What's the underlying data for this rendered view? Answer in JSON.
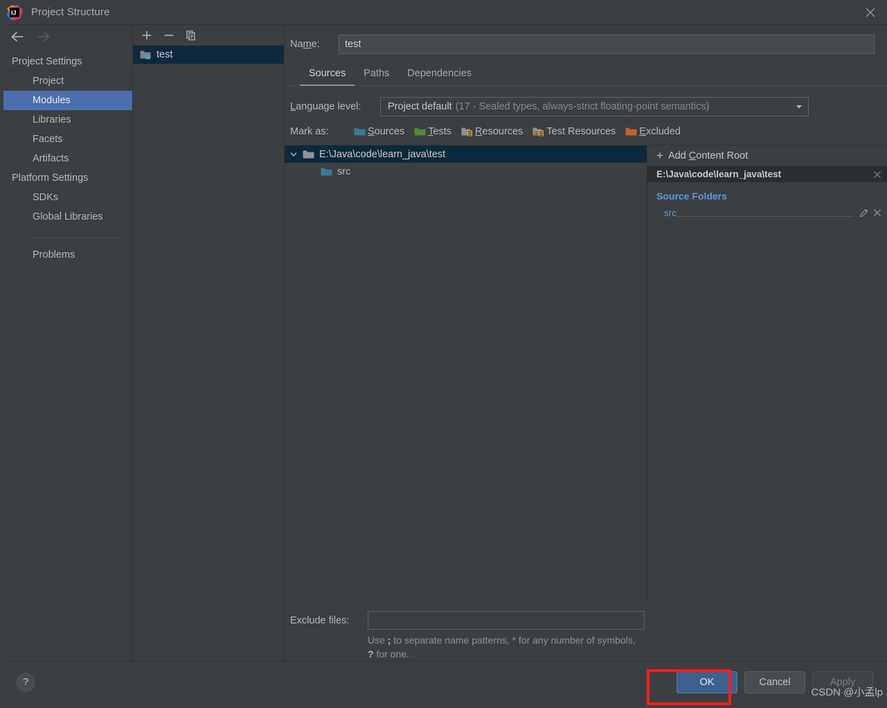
{
  "window": {
    "title": "Project Structure",
    "app_icon": "intellij-idea-icon",
    "close_label": "×"
  },
  "sidebar": {
    "back_icon": "arrow-left-icon",
    "forward_icon": "arrow-right-icon",
    "groups": [
      {
        "label": "Project Settings",
        "items": [
          {
            "label": "Project",
            "selected": false
          },
          {
            "label": "Modules",
            "selected": true
          },
          {
            "label": "Libraries",
            "selected": false
          },
          {
            "label": "Facets",
            "selected": false
          },
          {
            "label": "Artifacts",
            "selected": false
          }
        ]
      },
      {
        "label": "Platform Settings",
        "items": [
          {
            "label": "SDKs",
            "selected": false
          },
          {
            "label": "Global Libraries",
            "selected": false
          }
        ]
      }
    ],
    "extra_items": [
      {
        "label": "Problems",
        "selected": false
      }
    ]
  },
  "modules_panel": {
    "toolbar": {
      "add_label": "+",
      "remove_label": "−",
      "copy_label": "copy-icon"
    },
    "modules": [
      {
        "name": "test",
        "selected": true,
        "icon": "module-folder-icon"
      }
    ]
  },
  "main": {
    "name_label": "Name:",
    "name_mnemonic": "m",
    "name_value": "test",
    "tabs": [
      {
        "label": "Sources",
        "active": true
      },
      {
        "label": "Paths",
        "active": false
      },
      {
        "label": "Dependencies",
        "active": false
      }
    ],
    "language_level": {
      "label": "Language level:",
      "label_mnemonic": "L",
      "value": "Project default",
      "hint": "(17 - Sealed types, always-strict floating-point semantics)",
      "arrow_icon": "chevron-down-icon"
    },
    "mark_as": {
      "label": "Mark as:",
      "options": [
        {
          "label": "Sources",
          "mnemonic": "S",
          "color": "#3a7a96",
          "icon": "folder-sources-icon"
        },
        {
          "label": "Tests",
          "mnemonic": "T",
          "color": "#4e8a3c",
          "icon": "folder-tests-icon"
        },
        {
          "label": "Resources",
          "mnemonic": "R",
          "color": "#8f9396",
          "icon": "folder-resources-icon"
        },
        {
          "label": "Test Resources",
          "mnemonic": "",
          "color": "#8f9396",
          "icon": "folder-test-resources-icon"
        },
        {
          "label": "Excluded",
          "mnemonic": "E",
          "color": "#c0622b",
          "icon": "folder-excluded-icon"
        }
      ]
    },
    "tree": [
      {
        "label": "E:\\Java\\code\\learn_java\\test",
        "selected": true,
        "expanded": true,
        "icon": "folder-icon",
        "color": "#8f9396",
        "depth": 0
      },
      {
        "label": "src",
        "selected": false,
        "expanded": false,
        "icon": "folder-sources-icon",
        "color": "#3a7a96",
        "depth": 1
      }
    ],
    "roots_panel": {
      "add_content_root": "Add Content Root",
      "add_content_root_mnemonic": "C",
      "add_icon": "plus-icon",
      "root_path": "E:\\Java\\code\\learn_java\\test",
      "root_close_icon": "close-icon",
      "sections": [
        {
          "title": "Source Folders",
          "title_color": "#5f97e0",
          "entries": [
            {
              "name": "src",
              "edit_icon": "pencil-icon",
              "remove_icon": "close-icon"
            }
          ]
        }
      ]
    },
    "exclude": {
      "label": "Exclude files:",
      "value": "",
      "hint_prefix": "Use ",
      "hint_sep": ";",
      "hint_mid": " to separate name patterns, * for any number of symbols, ",
      "hint_q": "?",
      "hint_suffix": " for one.",
      "hint_full": "Use ; to separate name patterns, * for any number of symbols, ? for one."
    }
  },
  "footer": {
    "help_label": "?",
    "ok_label": "OK",
    "cancel_label": "Cancel",
    "apply_label": "Apply",
    "ok_highlight_color": "#fb1d1d"
  },
  "watermark": "CSDN @小孟lp",
  "backdrop_text": "... .. . . .. ..  ..."
}
